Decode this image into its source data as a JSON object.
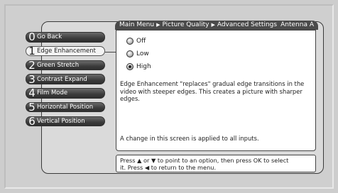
{
  "header": {
    "breadcrumb": [
      "Main Menu",
      "Picture Quality",
      "Advanced Settings"
    ],
    "input_source": "Antenna A"
  },
  "menu": {
    "items": [
      {
        "number": "0",
        "label": "Go Back"
      },
      {
        "number": "1",
        "label": "Edge Enhancement",
        "selected": true
      },
      {
        "number": "2",
        "label": "Green Stretch"
      },
      {
        "number": "3",
        "label": "Contrast Expand"
      },
      {
        "number": "4",
        "label": "Film Mode"
      },
      {
        "number": "5",
        "label": "Horizontal Position"
      },
      {
        "number": "6",
        "label": "Vertical Position"
      }
    ]
  },
  "options": [
    {
      "label": "Off"
    },
    {
      "label": "Low"
    },
    {
      "label": "High",
      "checked": true
    }
  ],
  "description": "Edge Enhancement \"replaces\" gradual edge transitions in the video with steeper edges. This creates a picture with sharper edges.",
  "note": "A change in this screen is applied to all inputs.",
  "help": {
    "line1": "Press ▲ or ▼ to point to an option, then press OK to select",
    "line2": "it. Press ◀ to return to the menu."
  },
  "colors": {
    "header_bg": "#4a4a4a",
    "menu_item_bg": "#3c3c3c",
    "selected_item_bg": "#f4f4f4"
  }
}
